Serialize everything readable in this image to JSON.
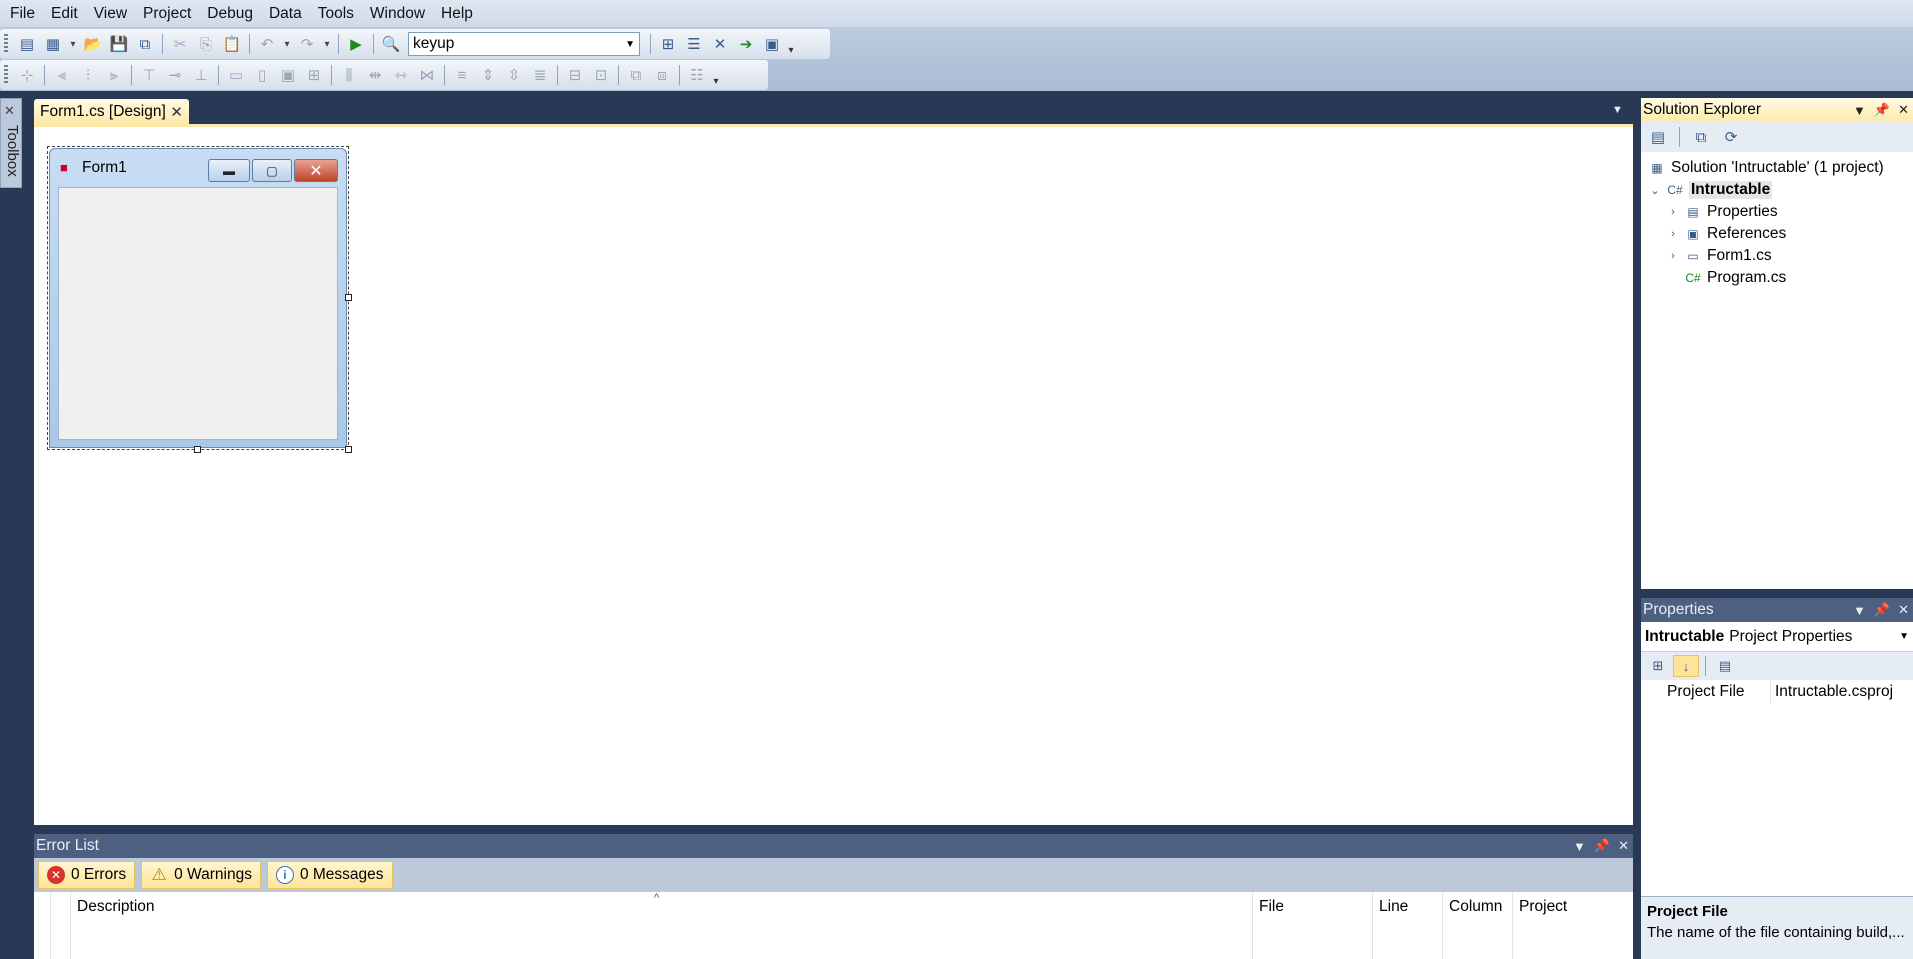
{
  "menu": [
    "File",
    "Edit",
    "View",
    "Project",
    "Debug",
    "Data",
    "Tools",
    "Window",
    "Help"
  ],
  "toolbar": {
    "config_combo_value": "keyup"
  },
  "toolbox": {
    "label": "Toolbox"
  },
  "document_tab": {
    "label": "Form1.cs [Design]"
  },
  "form": {
    "title": "Form1"
  },
  "error_list": {
    "title": "Error List",
    "errors_label": "0 Errors",
    "warnings_label": "0 Warnings",
    "messages_label": "0 Messages",
    "columns": [
      "Description",
      "File",
      "Line",
      "Column",
      "Project"
    ]
  },
  "solution_explorer": {
    "title": "Solution Explorer",
    "solution_label": "Solution 'Intructable' (1 project)",
    "project_label": "Intructable",
    "items": [
      "Properties",
      "References",
      "Form1.cs",
      "Program.cs"
    ]
  },
  "properties": {
    "title": "Properties",
    "object_name": "Intructable",
    "object_type": "Project Properties",
    "row_name": "Project File",
    "row_value": "Intructable.csproj",
    "desc_title": "Project File",
    "desc_text": "The name of the file containing build,..."
  },
  "colors": {
    "chrome_dark": "#293955",
    "pane_header": "#4d6082",
    "active_tab": "#fde9a8"
  }
}
